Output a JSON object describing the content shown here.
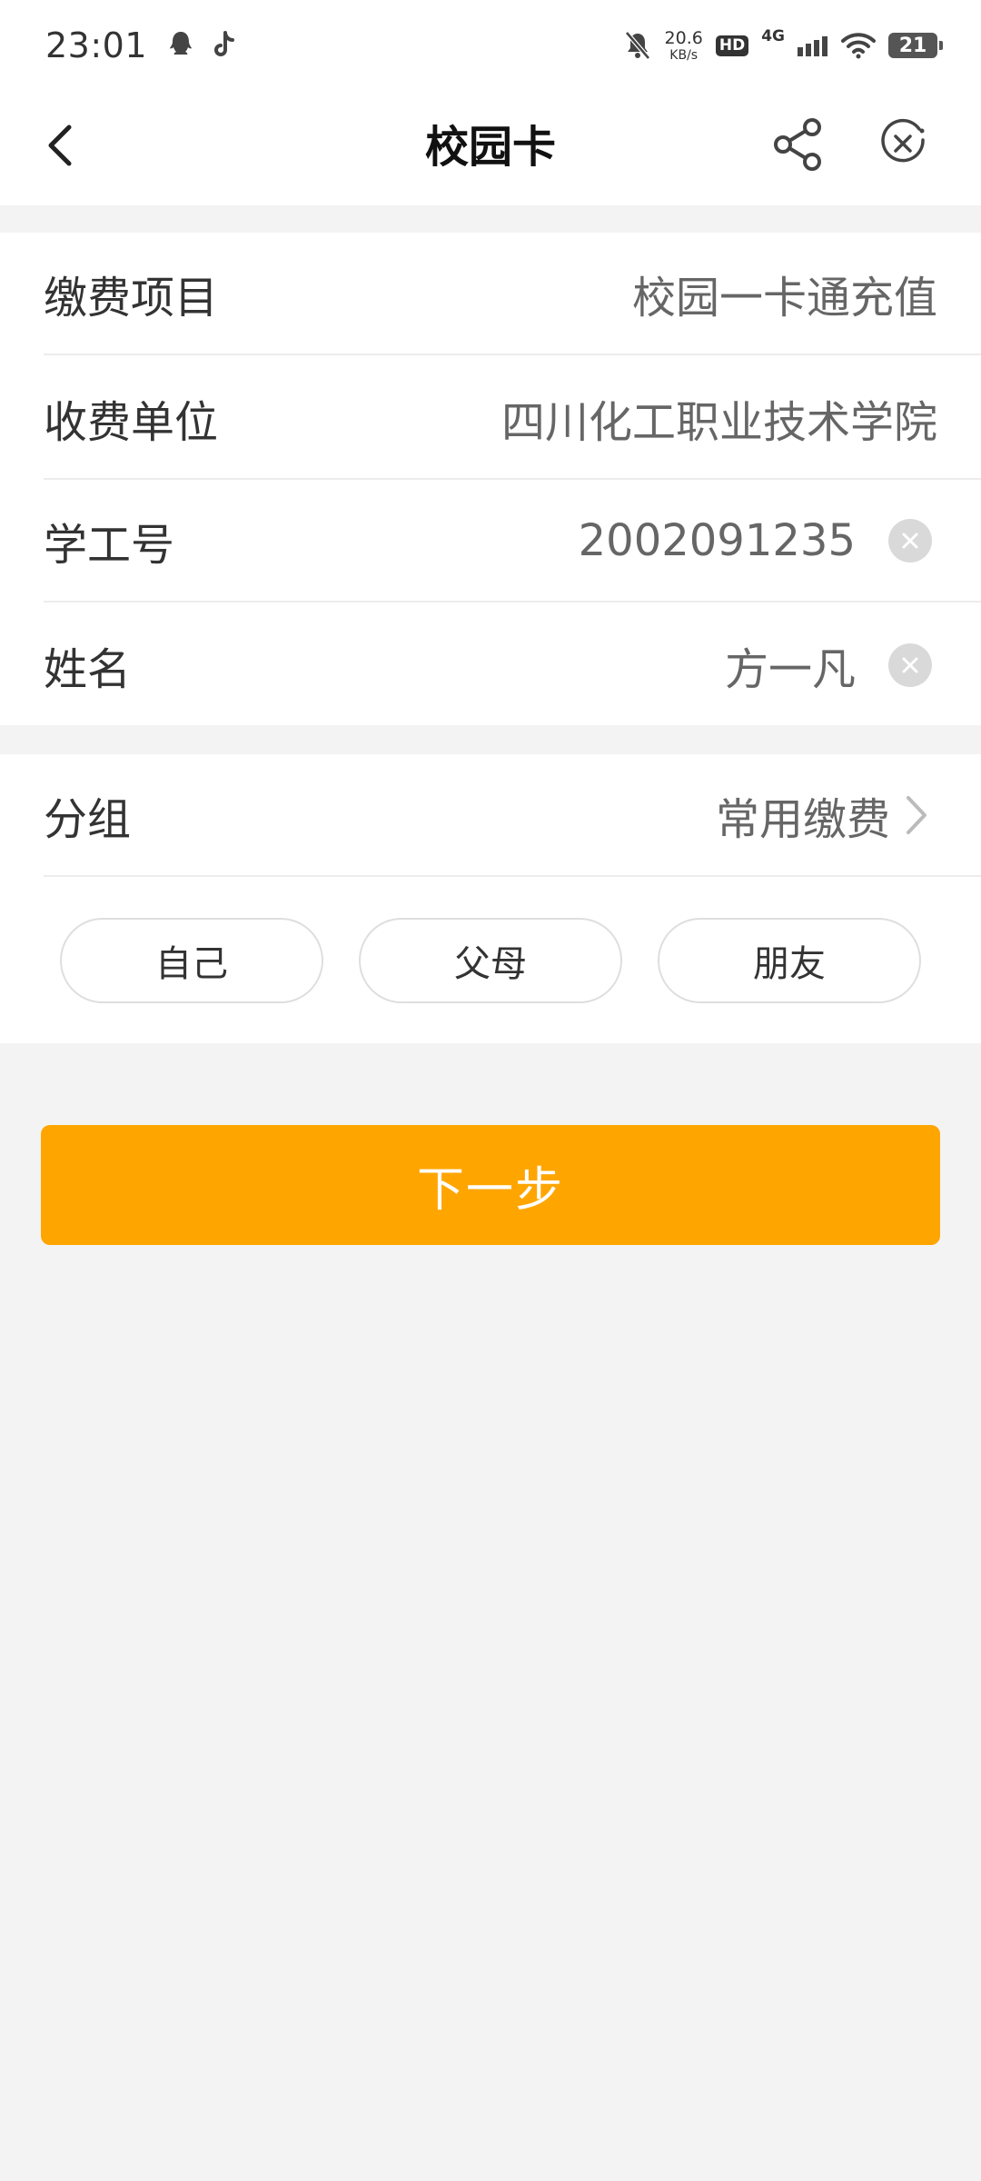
{
  "status_bar": {
    "time": "23:01",
    "speed_value": "20.6",
    "speed_unit": "KB/s",
    "hd": "HD",
    "network": "4G",
    "battery": "21",
    "icons": [
      "qq-icon",
      "tiktok-icon",
      "mute-icon",
      "signal-icon",
      "wifi-icon",
      "battery-icon"
    ]
  },
  "header": {
    "title": "校园卡",
    "icons": [
      "back-icon",
      "share-icon",
      "close-circle-icon"
    ]
  },
  "form": {
    "fee_item_label": "缴费项目",
    "fee_item_value": "校园一卡通充值",
    "payee_label": "收费单位",
    "payee_value": "四川化工职业技术学院",
    "student_id_label": "学工号",
    "student_id_value": "2002091235",
    "name_label": "姓名",
    "name_value": "方一凡"
  },
  "group": {
    "label": "分组",
    "value": "常用缴费",
    "chips": [
      "自己",
      "父母",
      "朋友"
    ]
  },
  "actions": {
    "next_label": "下一步"
  },
  "colors": {
    "accent": "#ffa500",
    "background": "#f3f3f3"
  }
}
